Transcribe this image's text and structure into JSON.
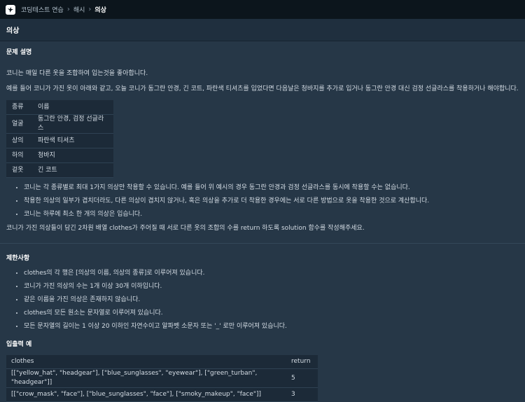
{
  "breadcrumb": {
    "items": [
      "코딩테스트 연습",
      "해시"
    ],
    "current": "의상"
  },
  "page_title": "의상",
  "problem": {
    "heading": "문제 설명",
    "intro": "코니는 매일 다른 옷을 조합하여 입는것을 좋아합니다.",
    "example": "예를 들어 코니가 가진 옷이 아래와 같고, 오늘 코니가 동그란 안경, 긴 코트, 파란색 티셔츠를 입었다면 다음날은 청바지를 추가로 입거나 동그란 안경 대신 검정 선글라스를 착용하거나 해야합니다.",
    "table": {
      "headers": [
        "종류",
        "이름"
      ],
      "rows": [
        [
          "얼굴",
          "동그란 안경, 검정 선글라스"
        ],
        [
          "상의",
          "파란색 티셔츠"
        ],
        [
          "하의",
          "청바지"
        ],
        [
          "겉옷",
          "긴 코트"
        ]
      ]
    },
    "bullets": [
      "코니는 각 종류별로 최대 1가지 의상만 착용할 수 있습니다. 예를 들어 위 예시의 경우 동그란 안경과 검정 선글라스를 동시에 착용할 수는 없습니다.",
      "착용한 의상의 일부가 겹치더라도, 다른 의상이 겹치지 않거나, 혹은 의상을 추가로 더 착용한 경우에는 서로 다른 방법으로 옷을 착용한 것으로 계산합니다.",
      "코니는 하루에 최소 한 개의 의상은 입습니다."
    ],
    "task": "코니가 가진 의상들이 담긴 2차원 배열 clothes가 주어질 때 서로 다른 옷의 조합의 수를 return 하도록 solution 함수를 작성해주세요."
  },
  "constraints": {
    "heading": "제한사항",
    "items": [
      "clothes의 각 행은 [의상의 이름, 의상의 종류]로 이루어져 있습니다.",
      "코니가 가진 의상의 수는 1개 이상 30개 이하입니다.",
      "같은 이름을 가진 의상은 존재하지 않습니다.",
      "clothes의 모든 원소는 문자열로 이루어져 있습니다.",
      "모든 문자열의 길이는 1 이상 20 이하인 자연수이고 알파벳 소문자 또는 '_' 로만 이루어져 있습니다."
    ]
  },
  "examples": {
    "heading": "입출력 예",
    "headers": [
      "clothes",
      "return"
    ],
    "rows": [
      [
        "[[\"yellow_hat\", \"headgear\"], [\"blue_sunglasses\", \"eyewear\"], [\"green_turban\", \"headgear\"]]",
        "5"
      ],
      [
        "[[\"crow_mask\", \"face\"], [\"blue_sunglasses\", \"face\"], [\"smoky_makeup\", \"face\"]]",
        "3"
      ]
    ]
  },
  "icons": {
    "logo": "bird-logo-icon",
    "separator": "chevron-right-icon"
  },
  "colors": {
    "background": "#263747",
    "topbar": "#0c151c",
    "table": "#1c2a38"
  }
}
